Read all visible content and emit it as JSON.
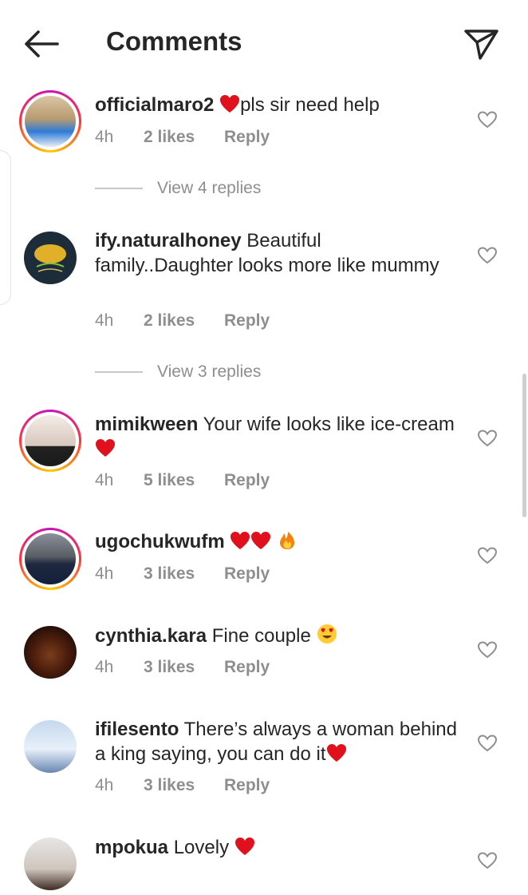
{
  "header": {
    "title": "Comments",
    "back_icon": "back-arrow-icon",
    "send_icon": "send-paper-plane-icon"
  },
  "comments": [
    {
      "username": "officialmaro2",
      "text": "pls sir need help",
      "text_prefix_emoji": "red-heart",
      "time": "4h",
      "likes": "2 likes",
      "reply": "Reply",
      "story_ring": true,
      "view_replies": "View 4 replies"
    },
    {
      "username": "ify.naturalhoney",
      "text": "Beautiful family..Daughter looks more like mummy",
      "time": "4h",
      "likes": "2 likes",
      "reply": "Reply",
      "story_ring": false,
      "view_replies": "View 3 replies"
    },
    {
      "username": "mimikween",
      "text": "Your wife looks like ice-cream ",
      "text_suffix_emoji": "red-heart",
      "time": "4h",
      "likes": "5 likes",
      "reply": "Reply",
      "story_ring": true
    },
    {
      "username": "ugochukwufm",
      "text": "",
      "emojis": [
        "red-heart",
        "red-heart",
        "fire"
      ],
      "time": "4h",
      "likes": "3 likes",
      "reply": "Reply",
      "story_ring": true
    },
    {
      "username": "cynthia.kara",
      "text": "Fine couple ",
      "text_suffix_emoji": "heart-eyes",
      "time": "4h",
      "likes": "3 likes",
      "reply": "Reply",
      "story_ring": false
    },
    {
      "username": "ifilesento",
      "text": "There’s always a woman behind a king saying, you can do it",
      "text_suffix_emoji": "red-heart",
      "time": "4h",
      "likes": "3 likes",
      "reply": "Reply",
      "story_ring": false
    },
    {
      "username": "mpokua",
      "text": "Lovely ",
      "text_suffix_emoji": "red-heart",
      "story_ring": false
    }
  ],
  "colors": {
    "text": "#262626",
    "secondary": "#8e8e8e",
    "heart_red": "#e0101d"
  }
}
